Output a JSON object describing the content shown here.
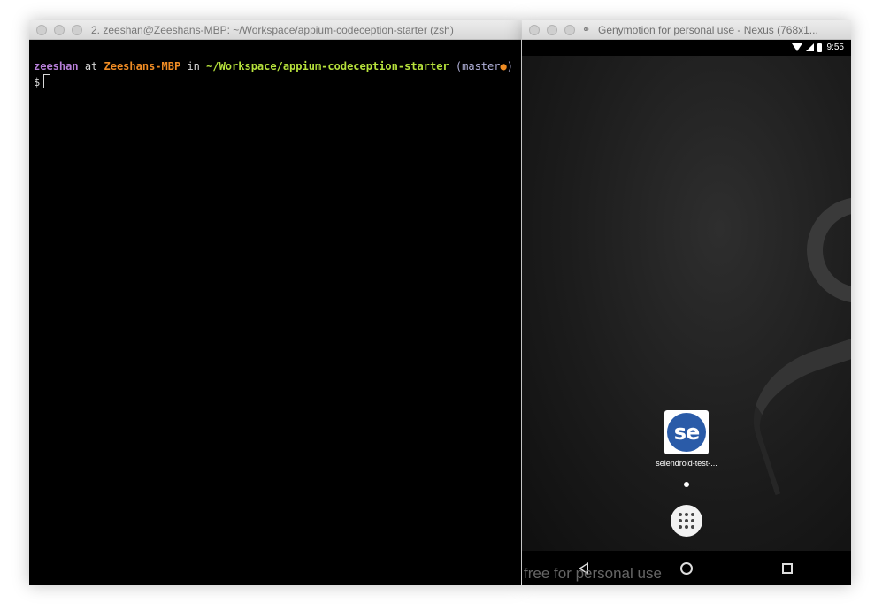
{
  "terminal": {
    "title": "2. zeeshan@Zeeshans-MBP: ~/Workspace/appium-codeception-starter (zsh)",
    "prompt": {
      "user": "zeeshan",
      "at": "at",
      "host": "Zeeshans-MBP",
      "in": "in",
      "path": "~/Workspace/appium-codeception-starter",
      "branch_open": "(master",
      "branch_dot": "●",
      "branch_close": ")",
      "symbol": "$"
    }
  },
  "genymotion": {
    "title": "Genymotion for personal use - Nexus (768x1...",
    "title_icon": "link-icon",
    "status_bar": {
      "time": "9:55",
      "icons": [
        "wifi-icon",
        "signal-icon",
        "battery-icon"
      ]
    },
    "home_screen": {
      "app": {
        "icon_text": "se",
        "label": "selendroid-test-..."
      },
      "drawer_icon": "app-drawer-icon"
    },
    "nav": [
      "back-icon",
      "home-icon",
      "recents-icon"
    ],
    "watermark": "free for personal use"
  },
  "colors": {
    "user": "#b77fd9",
    "host": "#f08c24",
    "path": "#b7e23c",
    "app_icon_bg": "#2a5ba8"
  }
}
